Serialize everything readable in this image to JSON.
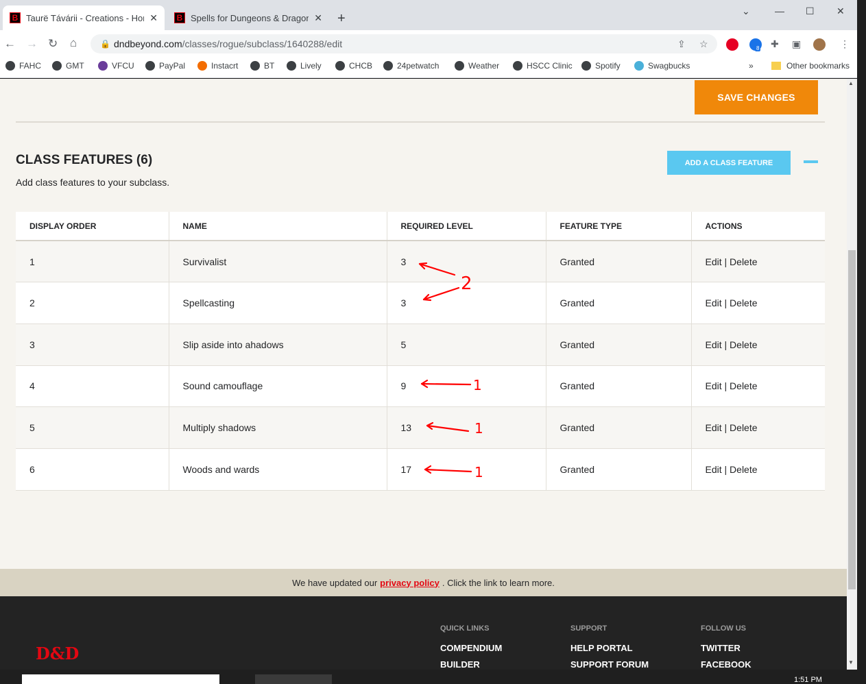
{
  "browser": {
    "tabs": [
      {
        "title": "Taurë Távárii - Creations - Homeb",
        "favicon": "B"
      },
      {
        "title": "Spells for Dungeons & Dragons (",
        "favicon": "B"
      }
    ],
    "url_host": "dndbeyond.com",
    "url_path": "/classes/rogue/subclass/1640288/edit",
    "bookmarks": [
      "FAHC",
      "GMT",
      "VFCU",
      "PayPal",
      "Instacrt",
      "BT",
      "Lively",
      "CHCB",
      "24petwatch",
      "Weather",
      "HSCC Clinic",
      "Spotify",
      "Swagbucks"
    ],
    "overflow": "»",
    "other_bookmarks": "Other bookmarks",
    "extension_badge": "8"
  },
  "page": {
    "save_label": "SAVE CHANGES",
    "section_title": "CLASS FEATURES (6)",
    "section_subtitle": "Add class features to your subclass.",
    "add_label": "ADD A CLASS FEATURE",
    "columns": [
      "DISPLAY ORDER",
      "NAME",
      "REQUIRED LEVEL",
      "FEATURE TYPE",
      "ACTIONS"
    ],
    "rows": [
      {
        "order": "1",
        "name": "Survivalist",
        "level": "3",
        "type": "Granted"
      },
      {
        "order": "2",
        "name": "Spellcasting",
        "level": "3",
        "type": "Granted"
      },
      {
        "order": "3",
        "name": "Slip aside into ahadows",
        "level": "5",
        "type": "Granted"
      },
      {
        "order": "4",
        "name": "Sound camouflage",
        "level": "9",
        "type": "Granted"
      },
      {
        "order": "5",
        "name": "Multiply shadows",
        "level": "13",
        "type": "Granted"
      },
      {
        "order": "6",
        "name": "Woods and wards",
        "level": "17",
        "type": "Granted"
      }
    ],
    "edit_label": "Edit",
    "action_sep": "|",
    "delete_label": "Delete",
    "annotation_numbers": [
      "2",
      "1",
      "1",
      "1"
    ]
  },
  "notice": {
    "before": "We have updated our",
    "link": "privacy policy",
    "after": ". Click the link to learn more."
  },
  "footer": {
    "logo": "D&D",
    "quick_links_head": "QUICK LINKS",
    "quick_links": [
      "COMPENDIUM",
      "BUILDER"
    ],
    "support_head": "SUPPORT",
    "support_links": [
      "HELP PORTAL",
      "SUPPORT FORUM"
    ],
    "follow_head": "FOLLOW US",
    "follow_links": [
      "TWITTER",
      "FACEBOOK"
    ]
  },
  "taskbar": {
    "time": "1:51 PM"
  },
  "colors": {
    "accent_orange": "#f0880a",
    "accent_blue": "#5ac8f0",
    "dnd_red": "#e40712",
    "annotation_red": "#ff0000"
  }
}
